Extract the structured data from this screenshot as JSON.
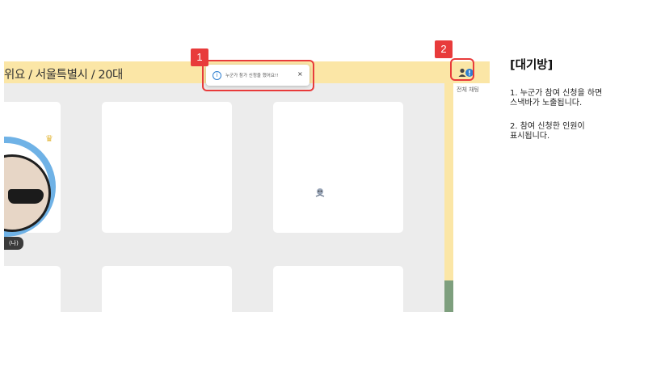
{
  "room": {
    "title": "위요 / 서울특별시 / 20대",
    "side_label": "전체 채팅",
    "avatar_tag": "(나)"
  },
  "snackbar": {
    "info_icon": "info-circle-icon",
    "message": "누군가 참가 신청을 했어요!!",
    "close_label": "×"
  },
  "annotations": [
    {
      "number": "1"
    },
    {
      "number": "2"
    }
  ],
  "panel": {
    "title": "[대기방]",
    "notes": [
      "1. 누군가 참여 신청을 하면\n스낵바가 노출됩니다.",
      "2. 참여 신청한 인원이\n표시됩니다."
    ]
  },
  "colors": {
    "bar": "#fbe6a6",
    "grid": "#ececec",
    "highlight": "#e83b3b",
    "avatar_ring": "#6fb2e6",
    "accent_blue": "#2f7fd0",
    "green_strip": "#7e9f7e"
  }
}
